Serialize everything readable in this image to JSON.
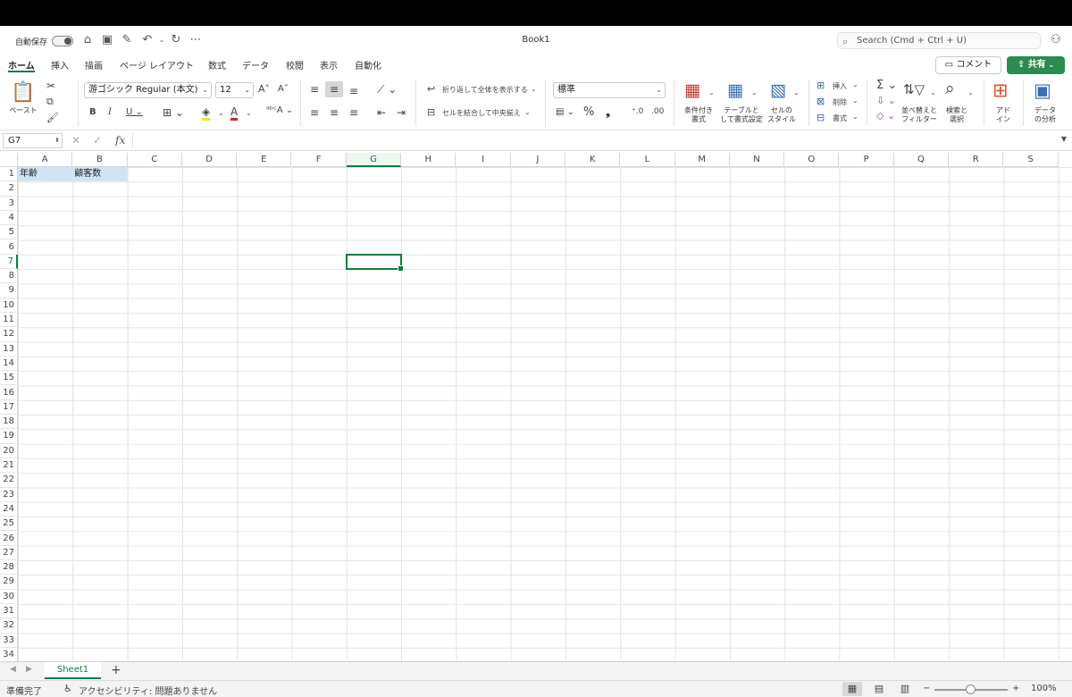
{
  "titlebar": {
    "autosave_label": "自動保存",
    "doc_title": "Book1",
    "search_placeholder": "Search (Cmd + Ctrl + U)"
  },
  "tabs": [
    "ホーム",
    "挿入",
    "描画",
    "ページ レイアウト",
    "数式",
    "データ",
    "校閲",
    "表示",
    "自動化"
  ],
  "active_tab": "ホーム",
  "header_buttons": {
    "comment": "コメント",
    "share": "共有"
  },
  "ribbon": {
    "paste_label": "ペースト",
    "font_name": "游ゴシック Regular (本文)",
    "font_size": "12",
    "wrap_text": "折り返して全体を表示する",
    "merge_center": "セルを結合して中央揃え",
    "number_format": "標準",
    "conditional_format": [
      "条件付き",
      "書式"
    ],
    "format_as_table": [
      "テーブルと",
      "して書式設定"
    ],
    "cell_styles": [
      "セルの",
      "スタイル"
    ],
    "insert": "挿入",
    "delete": "削除",
    "format": "書式",
    "sort_filter": [
      "並べ替えと",
      "フィルター"
    ],
    "find_select": [
      "検索と",
      "選択"
    ],
    "addins": [
      "アド",
      "イン"
    ],
    "analyze_data": [
      "データ",
      "の分析"
    ]
  },
  "formula_bar": {
    "name_box": "G7",
    "fx": "fx",
    "formula": ""
  },
  "columns": [
    "A",
    "B",
    "C",
    "D",
    "E",
    "F",
    "G",
    "H",
    "I",
    "J",
    "K",
    "L",
    "M",
    "N",
    "O",
    "P",
    "Q",
    "R",
    "S"
  ],
  "selected_column": "G",
  "selected_row": "7",
  "cells": {
    "A1": "年齢",
    "B1": "顧客数"
  },
  "sheet_tabs": {
    "active": "Sheet1",
    "add": "+"
  },
  "status": {
    "ready": "準備完了",
    "accessibility": "アクセシビリティ: 問題ありません",
    "zoom": "100%"
  },
  "colors": {
    "accent": "#107c41",
    "highlight": "#cfe4f4",
    "share": "#2e8b4f"
  }
}
